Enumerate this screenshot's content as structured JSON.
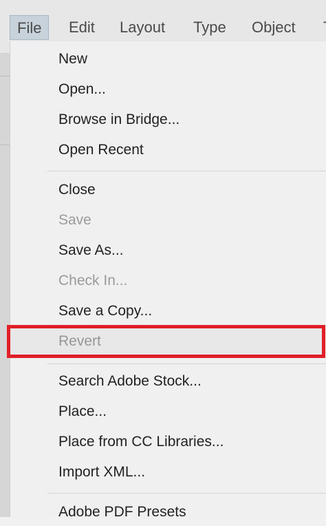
{
  "menubar": {
    "items": [
      {
        "label": "File"
      },
      {
        "label": "Edit"
      },
      {
        "label": "Layout"
      },
      {
        "label": "Type"
      },
      {
        "label": "Object"
      },
      {
        "label": "T"
      }
    ]
  },
  "file_menu": {
    "items": [
      {
        "label": "New"
      },
      {
        "label": "Open..."
      },
      {
        "label": "Browse in Bridge..."
      },
      {
        "label": "Open Recent"
      },
      {
        "label": "Close"
      },
      {
        "label": "Save"
      },
      {
        "label": "Save As..."
      },
      {
        "label": "Check In..."
      },
      {
        "label": "Save a Copy..."
      },
      {
        "label": "Revert"
      },
      {
        "label": "Search Adobe Stock..."
      },
      {
        "label": "Place..."
      },
      {
        "label": "Place from CC Libraries..."
      },
      {
        "label": "Import XML..."
      },
      {
        "label": "Adobe PDF Presets"
      }
    ]
  },
  "colors": {
    "highlight": "#e01f28",
    "disabled_text": "#9b9b9b",
    "active_menu_bg": "#c7d2db"
  }
}
